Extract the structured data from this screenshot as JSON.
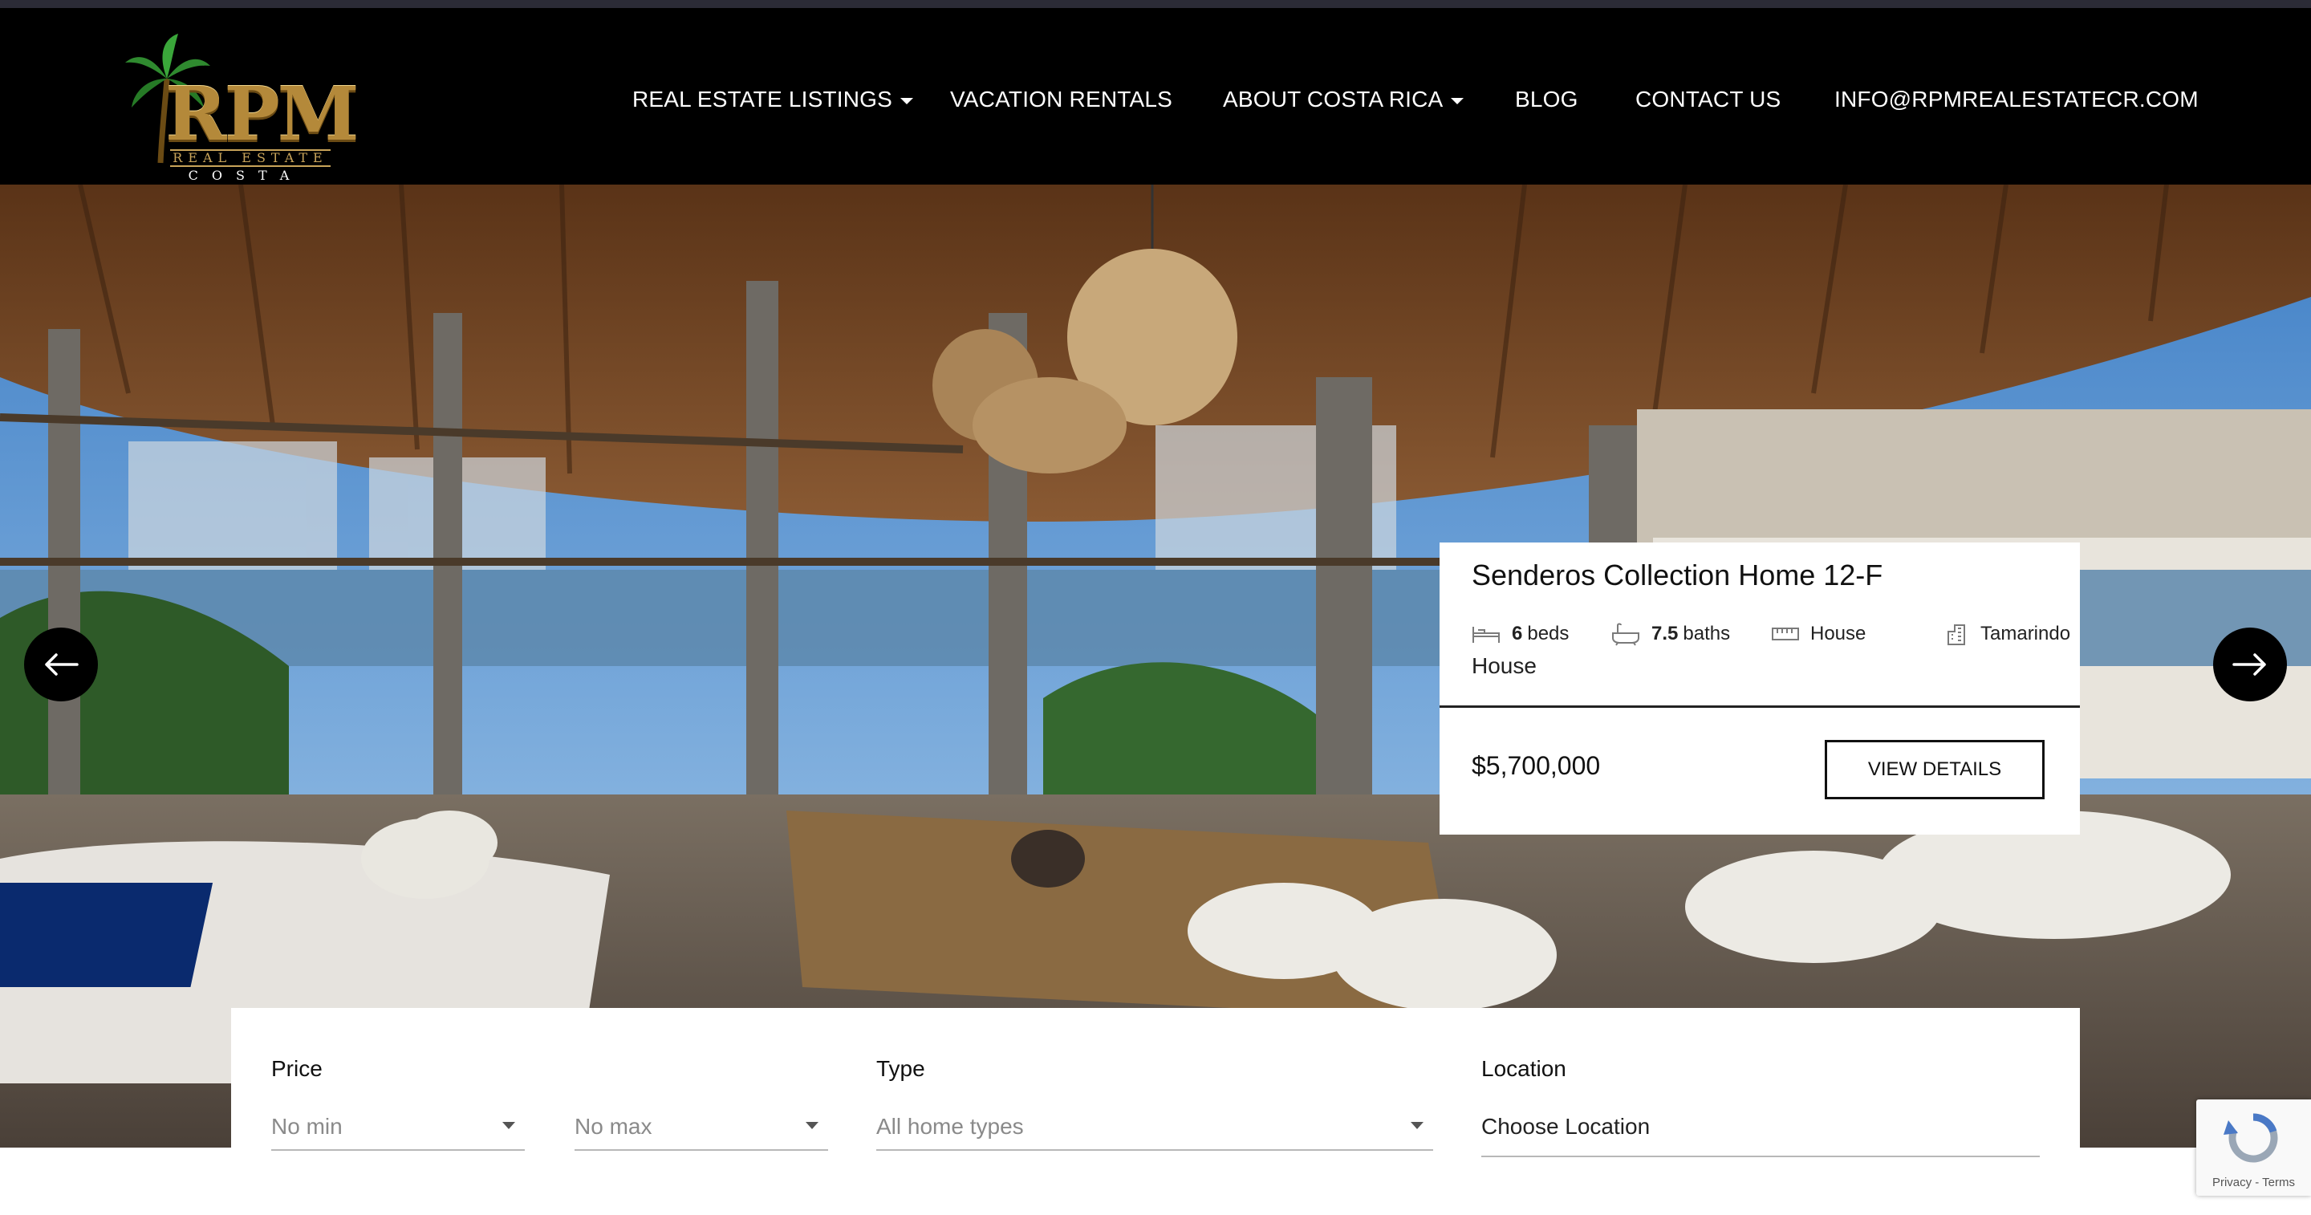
{
  "brand": {
    "name": "RPM",
    "line1": "REAL ESTATE",
    "line2": "COSTA RICA"
  },
  "nav": {
    "items": [
      {
        "label": "REAL ESTATE LISTINGS",
        "dropdown": true
      },
      {
        "label": "VACATION RENTALS",
        "dropdown": false
      },
      {
        "label": "ABOUT COSTA RICA",
        "dropdown": true
      },
      {
        "label": "BLOG",
        "dropdown": false
      },
      {
        "label": "CONTACT US",
        "dropdown": false
      },
      {
        "label": "INFO@RPMREALESTATECR.COM",
        "dropdown": false
      }
    ]
  },
  "carousel": {
    "prev_icon": "arrow-left-icon",
    "next_icon": "arrow-right-icon"
  },
  "listing": {
    "title": "Senderos Collection Home 12-F",
    "beds_value": "6",
    "beds_unit": "beds",
    "baths_value": "7.5",
    "baths_unit": "baths",
    "property_type": "House",
    "location": "Tamarindo",
    "type_label": "House",
    "price": "$5,700,000",
    "cta": "VIEW DETAILS"
  },
  "search": {
    "price_label": "Price",
    "min_placeholder": "No min",
    "max_placeholder": "No max",
    "type_label": "Type",
    "type_placeholder": "All home types",
    "location_label": "Location",
    "location_value": "Choose Location"
  },
  "recaptcha": {
    "links": "Privacy - Terms"
  },
  "colors": {
    "header_bg": "#000000",
    "brand_gold": "#b4893a",
    "card_bg": "#ffffff",
    "button_border": "#111111"
  }
}
